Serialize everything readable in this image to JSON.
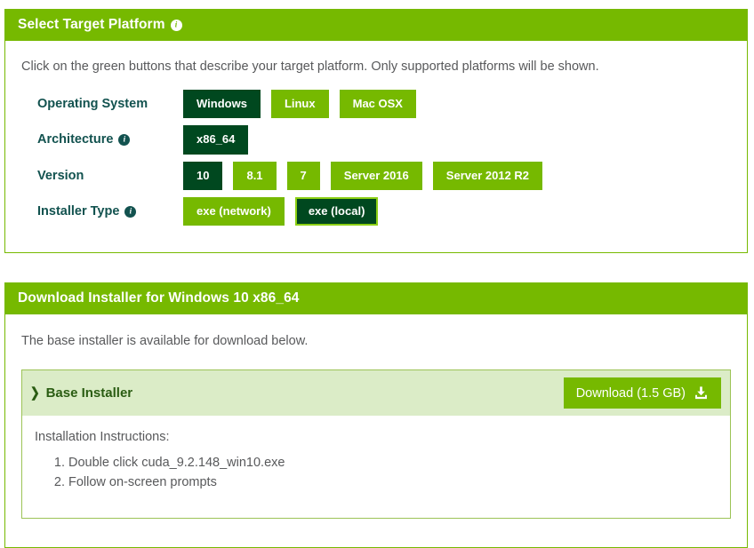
{
  "platform_panel": {
    "header_title": "Select Target Platform",
    "header_info_icon": "info-icon",
    "intro": "Click on the green buttons that describe your target platform. Only supported platforms will be shown.",
    "rows": [
      {
        "label": "Operating System",
        "has_info": false,
        "buttons": [
          {
            "label": "Windows",
            "state": "selected"
          },
          {
            "label": "Linux",
            "state": "normal"
          },
          {
            "label": "Mac OSX",
            "state": "normal"
          }
        ]
      },
      {
        "label": "Architecture",
        "has_info": true,
        "buttons": [
          {
            "label": "x86_64",
            "state": "selected"
          }
        ]
      },
      {
        "label": "Version",
        "has_info": false,
        "buttons": [
          {
            "label": "10",
            "state": "selected"
          },
          {
            "label": "8.1",
            "state": "normal"
          },
          {
            "label": "7",
            "state": "normal"
          },
          {
            "label": "Server 2016",
            "state": "normal"
          },
          {
            "label": "Server 2012 R2",
            "state": "normal"
          }
        ]
      },
      {
        "label": "Installer Type",
        "has_info": true,
        "buttons": [
          {
            "label": "exe (network)",
            "state": "normal"
          },
          {
            "label": "exe (local)",
            "state": "focused"
          }
        ]
      }
    ]
  },
  "download_panel": {
    "header_title": "Download Installer for Windows 10 x86_64",
    "intro": "The base installer is available for download below.",
    "installer": {
      "chevron": "❯",
      "title": "Base Installer",
      "download_label": "Download (1.5 GB)",
      "download_icon": "download-icon",
      "instructions_title": "Installation Instructions:",
      "instructions": [
        "Double click cuda_9.2.148_win10.exe",
        "Follow on-screen prompts"
      ]
    }
  },
  "colors": {
    "brand_green": "#76b900",
    "dark_green": "#00481f",
    "focus_green": "#8ccf14",
    "light_green_band": "#dbecc7",
    "teal_label": "#12524f",
    "body_text": "#58595b"
  }
}
